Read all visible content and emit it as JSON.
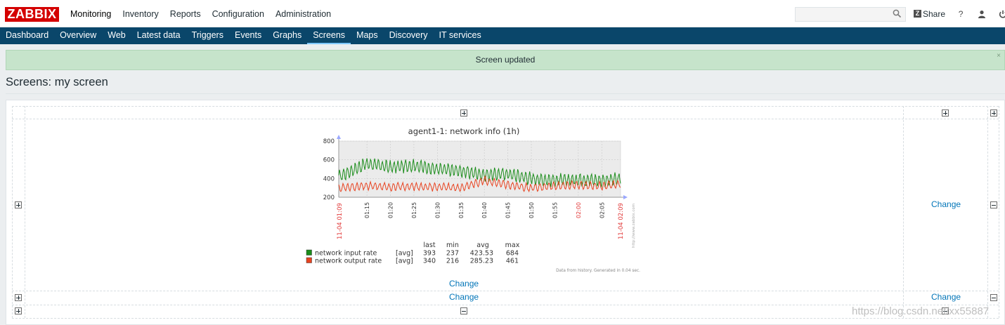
{
  "header": {
    "logo": "ZABBIX",
    "menu": [
      "Monitoring",
      "Inventory",
      "Reports",
      "Configuration",
      "Administration"
    ],
    "share_label": "Share",
    "help_icon": "?",
    "search_placeholder": ""
  },
  "submenu": {
    "items": [
      "Dashboard",
      "Overview",
      "Web",
      "Latest data",
      "Triggers",
      "Events",
      "Graphs",
      "Screens",
      "Maps",
      "Discovery",
      "IT services"
    ],
    "active": "Screens"
  },
  "message": {
    "text": "Screen updated",
    "close": "×"
  },
  "page": {
    "title": "Screens: my screen"
  },
  "screen": {
    "change_links": [
      "Change",
      "Change",
      "Change",
      "Change"
    ]
  },
  "graph": {
    "title": "agent1-1: network info (1h)",
    "y_ticks": [
      "800",
      "600",
      "400",
      "200"
    ],
    "x_ticks": [
      "01:15",
      "01:20",
      "01:25",
      "01:30",
      "01:35",
      "01:40",
      "01:45",
      "01:50",
      "01:55",
      "02:00",
      "02:05"
    ],
    "x_start": "11-04 01:09",
    "x_end": "11-04 02:09",
    "side_text": "http://www.zabbix.com",
    "legend_headers": [
      "last",
      "min",
      "avg",
      "max"
    ],
    "legend": [
      {
        "name": "network input rate",
        "func": "[avg]",
        "last": "393",
        "min": "237",
        "avg": "423.53",
        "max": "684",
        "color": "#1a8c1a"
      },
      {
        "name": "network output rate",
        "func": "[avg]",
        "last": "340",
        "min": "216",
        "avg": "285.23",
        "max": "461",
        "color": "#e8421f"
      }
    ],
    "footer": "Data from history. Generated in 0.04 sec."
  },
  "chart_data": {
    "type": "line",
    "title": "agent1-1: network info (1h)",
    "ylim": [
      200,
      800
    ],
    "x": [
      "01:09",
      "01:15",
      "01:20",
      "01:25",
      "01:30",
      "01:35",
      "01:40",
      "01:45",
      "01:50",
      "01:55",
      "02:00",
      "02:05",
      "02:09"
    ],
    "series": [
      {
        "name": "network input rate",
        "values": [
          420,
          560,
          520,
          540,
          500,
          480,
          440,
          450,
          400,
          380,
          390,
          380,
          393
        ]
      },
      {
        "name": "network output rate",
        "values": [
          300,
          320,
          310,
          315,
          310,
          300,
          380,
          330,
          300,
          320,
          330,
          320,
          340
        ]
      }
    ],
    "grid": true
  },
  "watermark": "https://blog.csdn.net/xx55887"
}
